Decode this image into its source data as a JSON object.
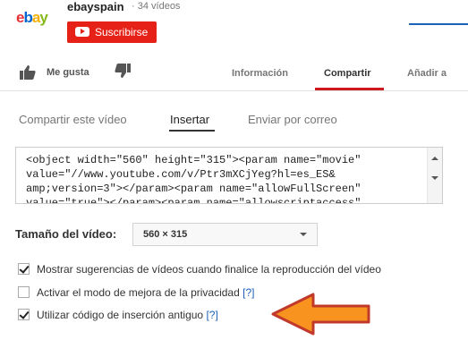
{
  "channel": {
    "logo_text": "ebay",
    "name": "ebayspain",
    "separator": "·",
    "video_count": "34 vídeos",
    "subscribe_label": "Suscribirse"
  },
  "actions": {
    "like_label": "Me gusta",
    "tabs": [
      {
        "label": "Información",
        "active": false
      },
      {
        "label": "Compartir",
        "active": true
      },
      {
        "label": "Añadir a",
        "active": false
      }
    ]
  },
  "share": {
    "subtabs": [
      {
        "label": "Compartir este vídeo",
        "active": false
      },
      {
        "label": "Insertar",
        "active": true
      },
      {
        "label": "Enviar por correo",
        "active": false
      }
    ],
    "embed_code": "<object width=\"560\" height=\"315\"><param name=\"movie\"\nvalue=\"//www.youtube.com/v/Ptr3mXCjYeg?hl=es_ES&\namp;version=3\"></param><param name=\"allowFullScreen\"\nvalue=\"true\"></param><param name=\"allowscriptaccess\"",
    "size_label": "Tamaño del vídeo:",
    "size_value": "560 × 315",
    "options": [
      {
        "label": "Mostrar sugerencias de vídeos cuando finalice la reproducción del vídeo",
        "checked": true,
        "help": ""
      },
      {
        "label": "Activar el modo de mejora de la privacidad",
        "checked": false,
        "help": "[?]"
      },
      {
        "label": "Utilizar código de inserción antiguo",
        "checked": true,
        "help": "[?]"
      }
    ]
  },
  "colors": {
    "subscribe": "#e62117",
    "tab_underline": "#cc181e",
    "link": "#1f61b9",
    "arrow": "#f7931e",
    "ebay_e": "#e53238",
    "ebay_b": "#0064d2",
    "ebay_a": "#f5af02",
    "ebay_y": "#86b817"
  },
  "icons": {
    "like": "thumbs-up-icon",
    "dislike": "thumbs-down-icon",
    "subscribe": "youtube-play-icon",
    "annotation": "orange-arrow-left"
  }
}
